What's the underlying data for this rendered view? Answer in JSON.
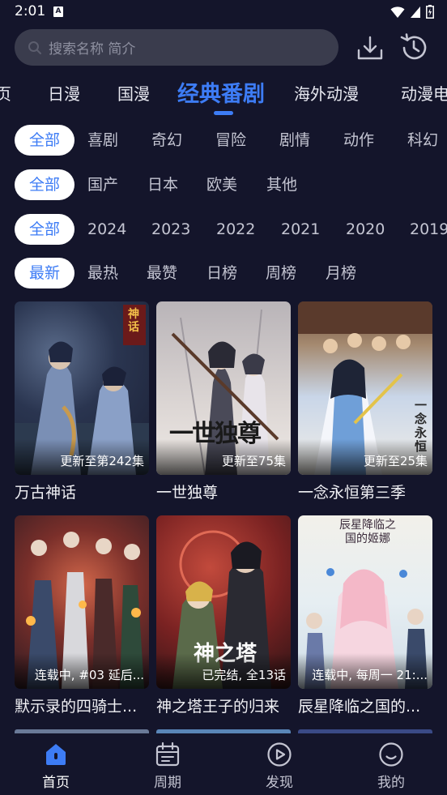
{
  "status": {
    "time": "2:01",
    "a_icon_letter": "A"
  },
  "search": {
    "placeholder": "搜索名称 简介"
  },
  "top_tabs": [
    "页",
    "日漫",
    "国漫",
    "经典番剧",
    "海外动漫",
    "动漫电"
  ],
  "active_tab": "经典番剧",
  "filters": {
    "genre": [
      "全部",
      "喜剧",
      "奇幻",
      "冒险",
      "剧情",
      "动作",
      "科幻"
    ],
    "region": [
      "全部",
      "国产",
      "日本",
      "欧美",
      "其他"
    ],
    "year": [
      "全部",
      "2024",
      "2023",
      "2022",
      "2021",
      "2020",
      "2019"
    ],
    "sort": [
      "最新",
      "最热",
      "最赞",
      "日榜",
      "周榜",
      "月榜"
    ]
  },
  "cards": [
    {
      "title": "万古神话",
      "caption": "更新至第242集",
      "poster_text": "神话"
    },
    {
      "title": "一世独尊",
      "caption": "更新至75集",
      "poster_text": "一世独尊"
    },
    {
      "title": "一念永恒第三季",
      "caption": "更新至25集",
      "poster_text": "一念永恒"
    },
    {
      "title": "默示录的四骑士...",
      "caption": "连载中, #03 延后...",
      "poster_text": ""
    },
    {
      "title": "神之塔王子的归来",
      "caption": "已完结, 全13话",
      "poster_text": "神之塔"
    },
    {
      "title": "辰星降临之国的...",
      "caption": "连载中, 每周一 21:...",
      "poster_text": "辰星降临之国的姬娜"
    }
  ],
  "bottom_nav": [
    {
      "label": "首页",
      "icon": "home-icon",
      "active": true
    },
    {
      "label": "周期",
      "icon": "calendar-icon",
      "active": false
    },
    {
      "label": "发现",
      "icon": "play-circle-icon",
      "active": false
    },
    {
      "label": "我的",
      "icon": "smile-face-icon",
      "active": false
    }
  ],
  "colors": {
    "background": "#14152b",
    "accent": "#3d7cf5",
    "search_bg": "#3a3c4d"
  }
}
